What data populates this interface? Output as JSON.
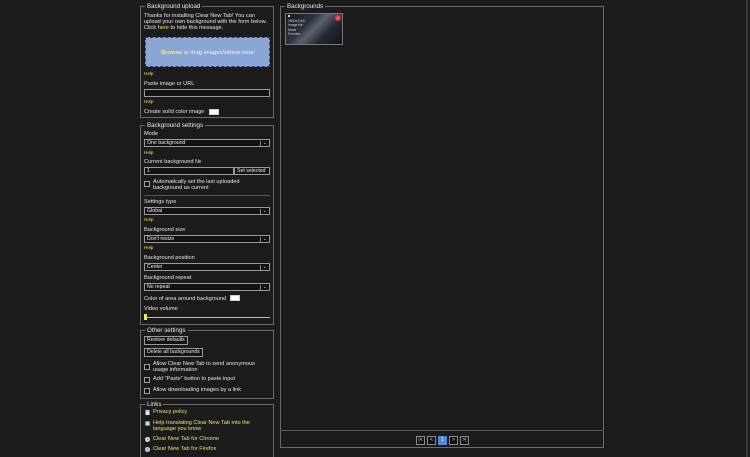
{
  "upload": {
    "legend": "Background upload",
    "intro_line1": "Thanks for installing Clear New Tab! You can",
    "intro_line2": "upload your own background with the form below.",
    "intro_click": "Click",
    "intro_here": "here",
    "intro_hide": "to hide this message.",
    "drop_browse": "Browse",
    "drop_text": "or drag images/videos here",
    "help1": "Help",
    "paste_label": "Paste image or URL",
    "paste_value": "",
    "help2": "Help",
    "solid_label": "Create solid color image",
    "solid_color": "#ffffff"
  },
  "settings": {
    "legend": "Background settings",
    "mode_label": "Mode",
    "mode_value": "One background",
    "help_mode": "Help",
    "current_label": "Current background №",
    "current_value": "1",
    "set_selected": "Set selected",
    "auto_set_line1": "Automatically set the last uploaded",
    "auto_set_line2": "background as current",
    "settings_type_label": "Settings type",
    "settings_type_value": "Global",
    "help_type": "Help",
    "size_label": "Background size",
    "size_value": "Don't resize",
    "help_size": "Help",
    "position_label": "Background position",
    "position_value": "Center",
    "repeat_label": "Background repeat",
    "repeat_value": "No repeat",
    "area_color_label": "Color of area around background",
    "area_color": "#ffffff",
    "volume_label": "Video volume",
    "volume_fraction": 0.0
  },
  "other": {
    "legend": "Other settings",
    "restore": "Restore defaults",
    "delete_all": "Delete all backgrounds",
    "anon_line1": "Allow Clear New Tab to send anonymous",
    "anon_line2": "usage information",
    "paste_btn": "Add \"Paste\" button to paste input",
    "allow_dl": "Allow downloading images by a link"
  },
  "links": {
    "legend": "Links",
    "privacy": "Privacy policy",
    "translate_line1": "Help translating Clear New Tab into the",
    "translate_line2": "language you know",
    "chrome": "Clear New Tab for Chrome",
    "firefox": "Clear New Tab for Firefox"
  },
  "backgrounds": {
    "legend": "Backgrounds",
    "items": [
      {
        "resolution": "3840x2160",
        "type": "Image file",
        "action1": "Move",
        "action2": "Preview",
        "close": "×"
      }
    ],
    "pager": {
      "first": "|<",
      "prev": "<",
      "current": "1",
      "next": ">",
      "last": ">|"
    }
  },
  "colors": {
    "accent_link": "#f0e26a",
    "dropzone": "#8aa6d4",
    "pager_active": "#4e8ad4",
    "close_badge": "#e4383f"
  }
}
